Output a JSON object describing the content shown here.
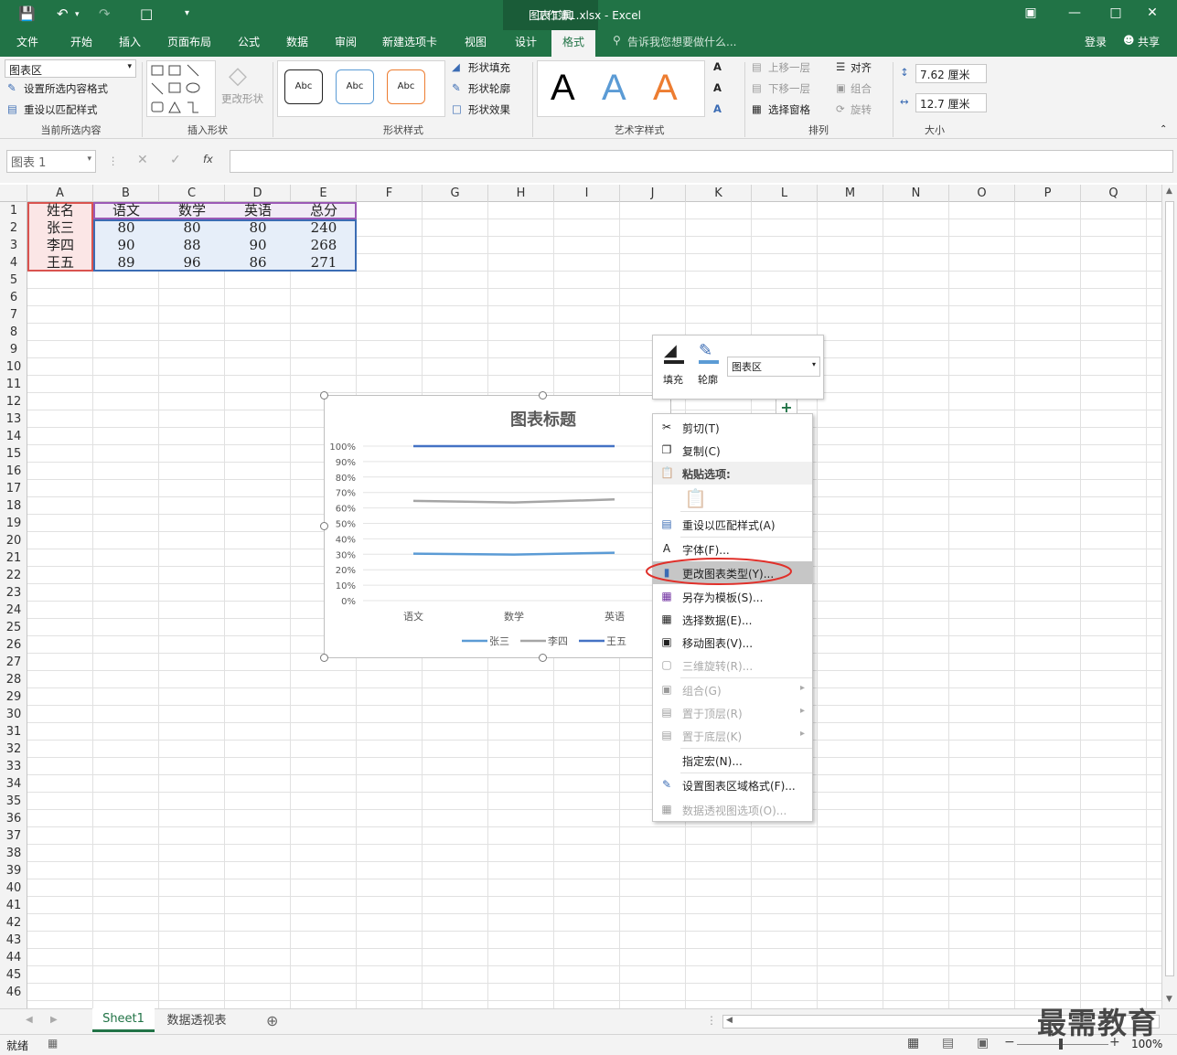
{
  "titlebar": {
    "title": "工作簿1.xlsx - Excel",
    "context_title": "图表工具"
  },
  "tabs": [
    "文件",
    "开始",
    "插入",
    "页面布局",
    "公式",
    "数据",
    "审阅",
    "新建选项卡",
    "视图",
    "设计",
    "格式"
  ],
  "tell_me": "告诉我您想要做什么...",
  "login": "登录",
  "share": "共享",
  "ribbon": {
    "selection_combo": "图表区",
    "format_selection": "设置所选内容格式",
    "reset_style": "重设以匹配样式",
    "group_current": "当前所选内容",
    "change_shape": "更改形状",
    "group_insert_shapes": "插入形状",
    "shape_style_sample": "Abc",
    "shape_fill": "形状填充",
    "shape_outline": "形状轮廓",
    "shape_effects": "形状效果",
    "group_shape_styles": "形状样式",
    "wordart_letter": "A",
    "group_wordart": "艺术字样式",
    "bring_forward": "上移一层",
    "send_backward": "下移一层",
    "selection_pane": "选择窗格",
    "align": "对齐",
    "group": "组合",
    "rotate": "旋转",
    "group_arrange": "排列",
    "height": "7.62 厘米",
    "width": "12.7 厘米",
    "group_size": "大小"
  },
  "formulabar": {
    "namebox": "图表 1",
    "fx": "fx"
  },
  "columns": [
    "A",
    "B",
    "C",
    "D",
    "E",
    "F",
    "G",
    "H",
    "I",
    "J",
    "K",
    "L",
    "M",
    "N",
    "O",
    "P",
    "Q"
  ],
  "rows": [
    "1",
    "2",
    "3",
    "4",
    "5",
    "6",
    "7",
    "8",
    "9",
    "10",
    "11",
    "12",
    "13",
    "14",
    "15",
    "16",
    "17",
    "18",
    "19",
    "20",
    "21",
    "22",
    "23",
    "24",
    "25",
    "26",
    "27",
    "28",
    "29",
    "30",
    "31",
    "32",
    "33",
    "34",
    "35",
    "36",
    "37",
    "38",
    "39",
    "40",
    "41",
    "42",
    "43",
    "44",
    "45",
    "46"
  ],
  "table": {
    "header": [
      "姓名",
      "语文",
      "数学",
      "英语",
      "总分"
    ],
    "rows": [
      [
        "张三",
        "80",
        "80",
        "80",
        "240"
      ],
      [
        "李四",
        "90",
        "88",
        "90",
        "268"
      ],
      [
        "王五",
        "89",
        "96",
        "86",
        "271"
      ]
    ]
  },
  "chart_data": {
    "type": "line",
    "title": "图表标题",
    "categories": [
      "语文",
      "数学",
      "英语"
    ],
    "ytick_labels": [
      "100%",
      "90%",
      "80%",
      "70%",
      "60%",
      "50%",
      "40%",
      "30%",
      "20%",
      "10%",
      "0%"
    ],
    "ylim": [
      0,
      1
    ],
    "legend": "bottom",
    "series": [
      {
        "name": "张三",
        "color": "#5b9bd5",
        "values": [
          0.304,
          0.298,
          0.31
        ]
      },
      {
        "name": "李四",
        "color": "#a5a5a5",
        "values": [
          0.646,
          0.635,
          0.655
        ]
      },
      {
        "name": "王五",
        "color": "#4472c4",
        "values": [
          1.0,
          1.0,
          1.0
        ]
      }
    ]
  },
  "minitoolbar": {
    "fill": "填充",
    "outline": "轮廓",
    "combo": "图表区"
  },
  "contextmenu": {
    "cut": "剪切(T)",
    "copy": "复制(C)",
    "paste_options": "粘贴选项:",
    "reset_style": "重设以匹配样式(A)",
    "font": "字体(F)...",
    "change_chart_type": "更改图表类型(Y)...",
    "save_template": "另存为模板(S)...",
    "select_data": "选择数据(E)...",
    "move_chart": "移动图表(V)...",
    "rotate3d": "三维旋转(R)...",
    "group": "组合(G)",
    "bring_front": "置于顶层(R)",
    "send_back": "置于底层(K)",
    "assign_macro": "指定宏(N)...",
    "format_chart_area": "设置图表区域格式(F)...",
    "pivot_options": "数据透视图选项(O)..."
  },
  "sheets": [
    "Sheet1",
    "数据透视表"
  ],
  "status": {
    "ready": "就绪",
    "zoom": "100%"
  },
  "watermark": "最需教育",
  "colors": {
    "excel_green": "#217346",
    "highlight_red": "#e0302a"
  }
}
